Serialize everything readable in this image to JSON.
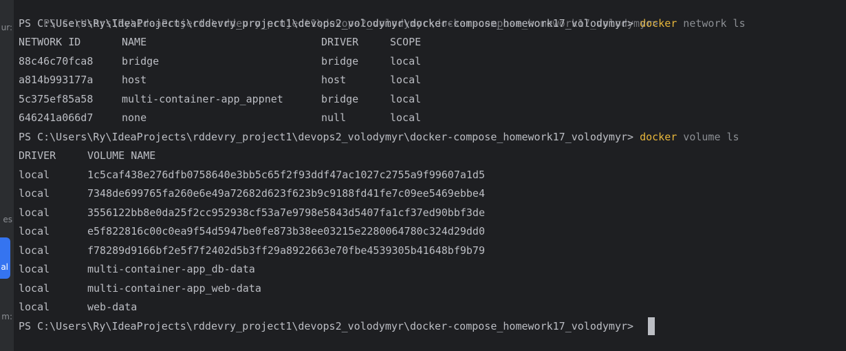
{
  "sidebar": {
    "fragments": [
      "ur:",
      "es",
      "m:"
    ],
    "button_label": "al"
  },
  "terminal": {
    "partial_top_line": "PS C:\\Users\\Ry\\IdeaProjects\\rddevry_project1\\devops2_volodymyr\\docker-compose_homework17_volodymyr> ",
    "prompt": "PS C:\\Users\\Ry\\IdeaProjects\\rddevry_project1\\devops2_volodymyr\\docker-compose_homework17_volodymyr> ",
    "network_cmd": {
      "bin": "docker",
      "args": "network ls"
    },
    "network_headers": [
      "NETWORK ID",
      "NAME",
      "DRIVER",
      "SCOPE"
    ],
    "networks": [
      {
        "id": "88c46c70fca8",
        "name": "bridge",
        "driver": "bridge",
        "scope": "local"
      },
      {
        "id": "a814b993177a",
        "name": "host",
        "driver": "host",
        "scope": "local"
      },
      {
        "id": "5c375ef85a58",
        "name": "multi-container-app_appnet",
        "driver": "bridge",
        "scope": "local"
      },
      {
        "id": "646241a066d7",
        "name": "none",
        "driver": "null",
        "scope": "local"
      }
    ],
    "volume_cmd": {
      "bin": "docker",
      "args": "volume ls"
    },
    "volume_headers": [
      "DRIVER",
      "VOLUME NAME"
    ],
    "volumes": [
      {
        "driver": "local",
        "name": "1c5caf438e276dfb0758640e3bb5c65f2f93ddf47ac1027c2755a9f99607a1d5"
      },
      {
        "driver": "local",
        "name": "7348de699765fa260e6e49a72682d623f623b9c9188fd41fe7c09ee5469ebbe4"
      },
      {
        "driver": "local",
        "name": "3556122bb8e0da25f2cc952938cf53a7e9798e5843d5407fa1cf37ed90bbf3de"
      },
      {
        "driver": "local",
        "name": "e5f822816c00c0ea9f54d5947be0fe873b38ee03215e2280064780c324d29dd0"
      },
      {
        "driver": "local",
        "name": "f78289d9166bf2e5f7f2402d5b3ff29a8922663e70fbe4539305b41648bf9b79"
      },
      {
        "driver": "local",
        "name": "multi-container-app_db-data"
      },
      {
        "driver": "local",
        "name": "multi-container-app_web-data"
      },
      {
        "driver": "local",
        "name": "web-data"
      }
    ]
  }
}
